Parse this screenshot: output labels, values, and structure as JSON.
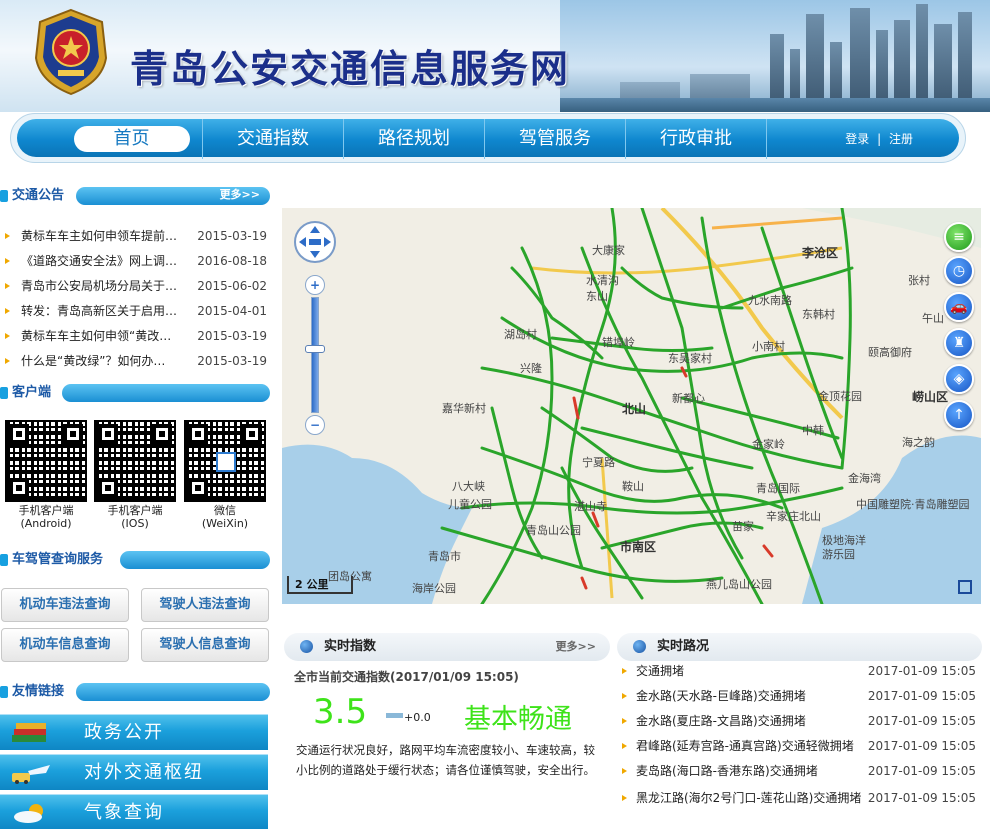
{
  "header": {
    "title": "青岛公安交通信息服务网"
  },
  "nav": {
    "items": [
      "首页",
      "交通指数",
      "路径规划",
      "驾管服务",
      "行政审批"
    ],
    "login": "登录",
    "sep": "|",
    "register": "注册"
  },
  "notice": {
    "title": "交通公告",
    "more": "更多>>",
    "items": [
      {
        "text": "黄标车车主如何申领车提前…",
        "date": "2015-03-19"
      },
      {
        "text": "《道路交通安全法》网上调…",
        "date": "2016-08-18"
      },
      {
        "text": "青岛市公安局机场分局关于…",
        "date": "2015-06-02"
      },
      {
        "text": "转发：青岛高新区关于启用…",
        "date": "2015-04-01"
      },
      {
        "text": "黄标车车主如何申领“黄改…",
        "date": "2015-03-19"
      },
      {
        "text": "什么是“黄改绿”？如何办…",
        "date": "2015-03-19"
      }
    ]
  },
  "client": {
    "title": "客户端",
    "qrs": [
      {
        "label": "手机客户端",
        "sub": "(Android)"
      },
      {
        "label": "手机客户端",
        "sub": "(IOS)"
      },
      {
        "label": "微信",
        "sub": "(WeiXin)"
      }
    ]
  },
  "driver": {
    "title": "车驾管查询服务",
    "buttons": [
      "机动车违法查询",
      "驾驶人违法查询",
      "机动车信息查询",
      "驾驶人信息查询"
    ]
  },
  "links": {
    "title": "友情链接",
    "items": [
      {
        "label": "政务公开",
        "icon": "books-icon"
      },
      {
        "label": "对外交通枢纽",
        "icon": "transport-icon"
      },
      {
        "label": "气象查询",
        "icon": "weather-icon"
      }
    ]
  },
  "map": {
    "scale": "2 公里",
    "labels": [
      "李沧区",
      "崂山区",
      "大康家",
      "水清沟",
      "东山",
      "湖岛村",
      "兴隆",
      "北山",
      "东韩村",
      "九水南路",
      "小南村",
      "错埠岭",
      "鞍山",
      "东吴家村",
      "新都心",
      "颐高御府",
      "金家岭",
      "金顶花园",
      "中韩",
      "青岛国际",
      "市南区",
      "嘉华新村",
      "苗家",
      "八大峡",
      "宁夏路",
      "辛家庄北山",
      "青岛山公园",
      "儿童公园",
      "湛山寺",
      "团岛公寓",
      "海岸公园",
      "极地海洋",
      "游乐园",
      "中国雕塑院·青岛雕塑园",
      "海之韵",
      "金海湾",
      "青岛市",
      "燕儿岛山公园",
      "午山",
      "张村"
    ],
    "colors": {
      "road": "#2aa52a",
      "jam": "#d83a2a"
    }
  },
  "index": {
    "title": "实时指数",
    "more": "更多>>",
    "subtitle": "全市当前交通指数(2017/01/09 15:05)",
    "value": "3.5",
    "delta": "+0.0",
    "status": "基本畅通",
    "desc": "交通运行状况良好，路网平均车流密度较小、车速较高，较小比例的道路处于缓行状态；请各位谨慎驾驶，安全出行。"
  },
  "road": {
    "title": "实时路况",
    "items": [
      {
        "text": "交通拥堵",
        "date": "2017-01-09 15:05"
      },
      {
        "text": "金水路(天水路-巨峰路)交通拥堵",
        "date": "2017-01-09 15:05"
      },
      {
        "text": "金水路(夏庄路-文昌路)交通拥堵",
        "date": "2017-01-09 15:05"
      },
      {
        "text": "君峰路(延寿宫路-通真宫路)交通轻微拥堵",
        "date": "2017-01-09 15:05"
      },
      {
        "text": "麦岛路(海口路-香港东路)交通拥堵",
        "date": "2017-01-09 15:05"
      },
      {
        "text": "黑龙江路(海尔2号门口-莲花山路)交通拥堵",
        "date": "2017-01-09 15:05"
      }
    ]
  }
}
